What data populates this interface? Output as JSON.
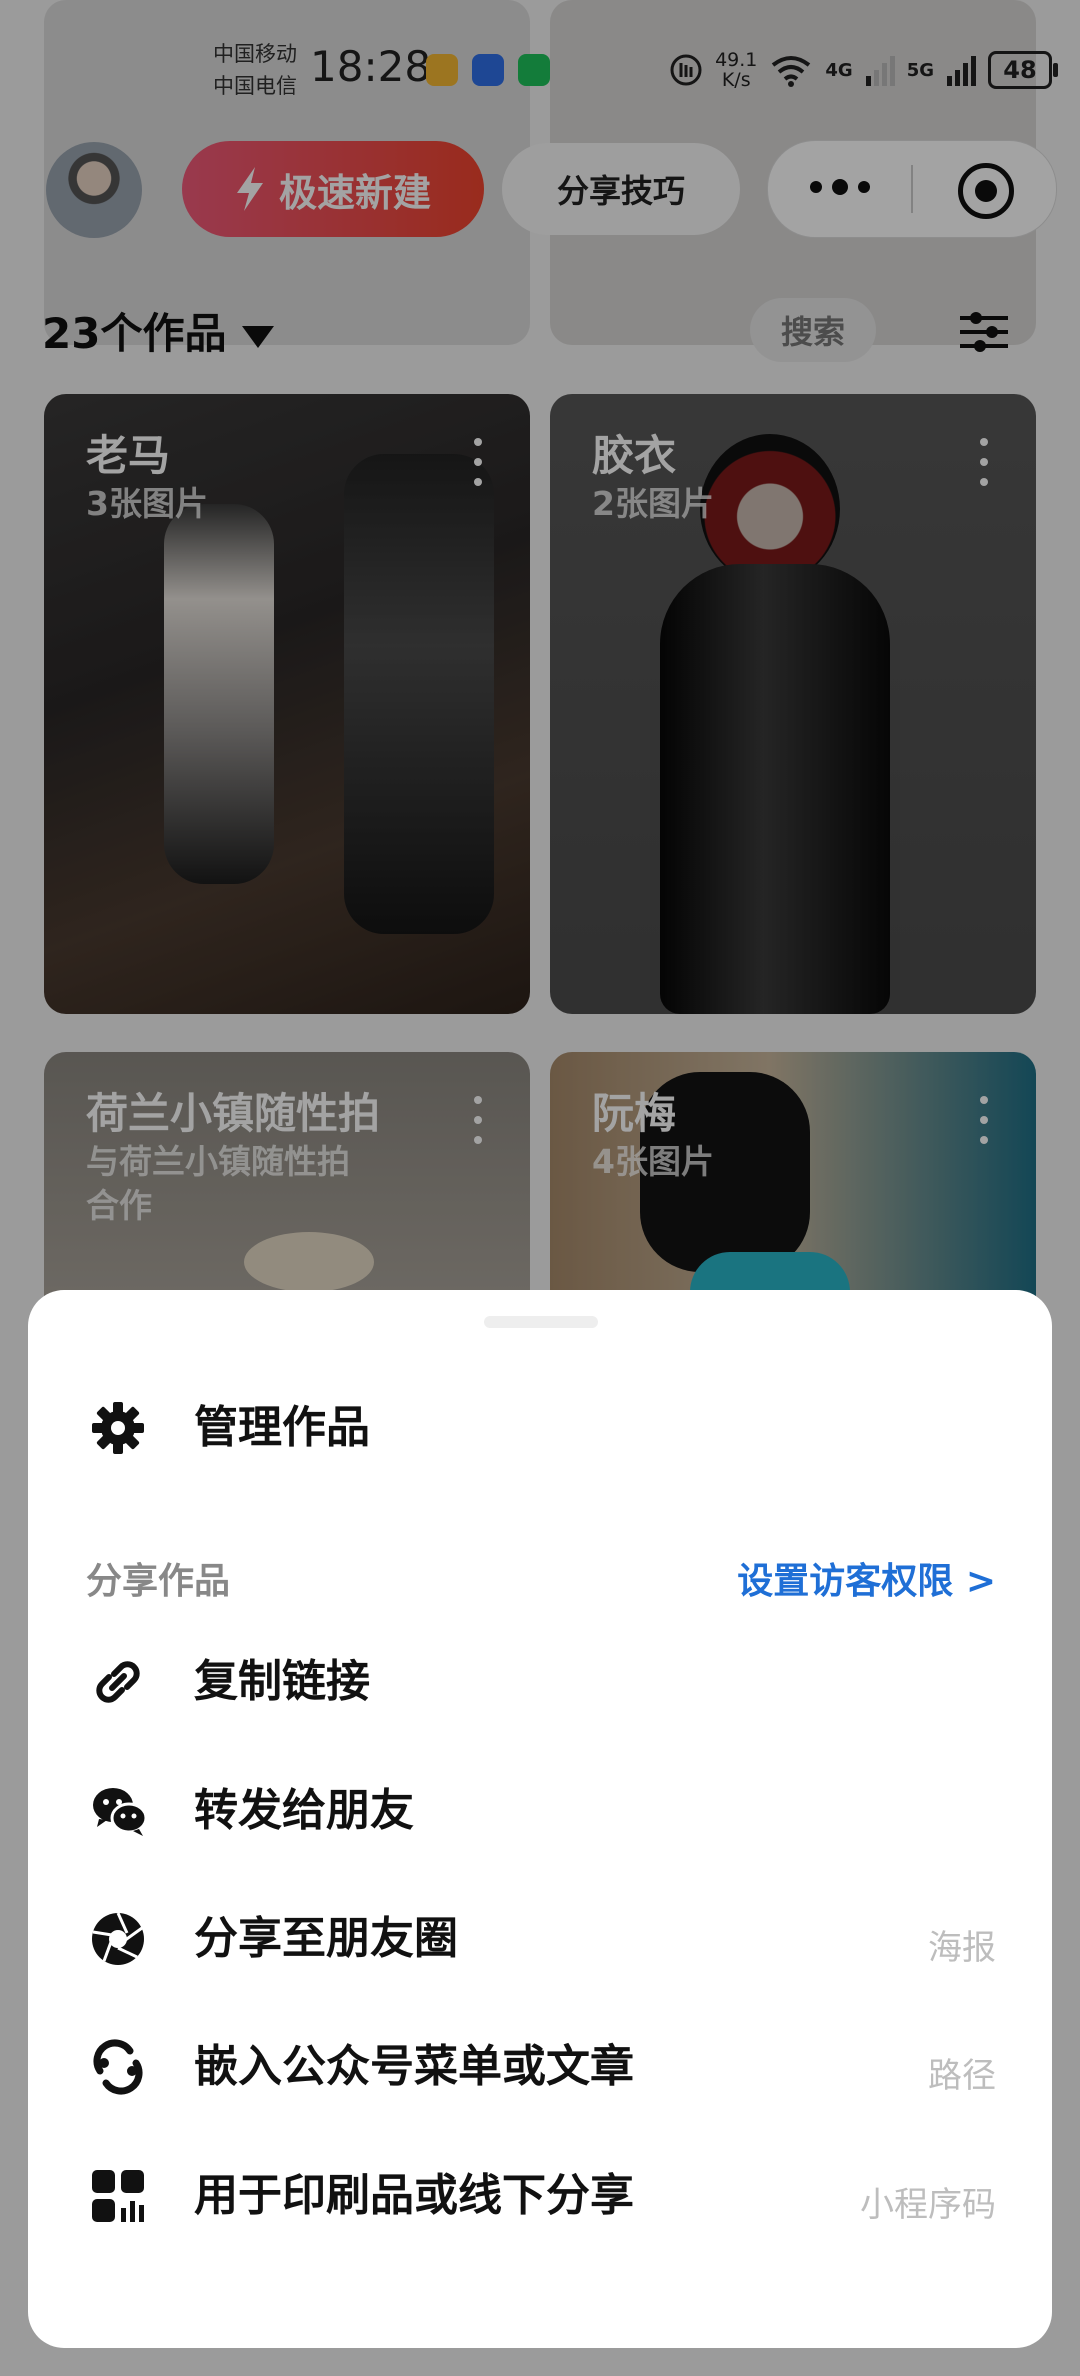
{
  "status_bar": {
    "carrier1": "中国移动",
    "carrier2": "中国电信",
    "time": "18:28",
    "speed_value": "49.1",
    "speed_unit": "K/s",
    "net1": "4G",
    "net2": "5G",
    "battery": "48"
  },
  "header": {
    "new_button_label": "极速新建",
    "tips_button_label": "分享技巧"
  },
  "toolbar": {
    "works_count": "23个作品",
    "search_label": "搜索"
  },
  "works": [
    {
      "title": "老马",
      "subtitle": "3张图片"
    },
    {
      "title": "胶衣",
      "subtitle": "2张图片"
    },
    {
      "title": "荷兰小镇随性拍",
      "subtitle": "与荷兰小镇随性拍",
      "subtitle2": "合作"
    },
    {
      "title": "阮梅",
      "subtitle": "4张图片"
    }
  ],
  "sheet": {
    "manage_label": "管理作品",
    "section_title": "分享作品",
    "permission_link": "设置访客权限 >",
    "items": [
      {
        "label": "复制链接",
        "hint": "",
        "icon": "link-icon"
      },
      {
        "label": "转发给朋友",
        "hint": "",
        "icon": "wechat-icon"
      },
      {
        "label": "分享至朋友圈",
        "hint": "海报",
        "icon": "moments-icon"
      },
      {
        "label": "嵌入公众号菜单或文章",
        "hint": "路径",
        "icon": "official-account-icon"
      },
      {
        "label": "用于印刷品或线下分享",
        "hint": "小程序码",
        "icon": "qrcode-icon"
      }
    ]
  }
}
